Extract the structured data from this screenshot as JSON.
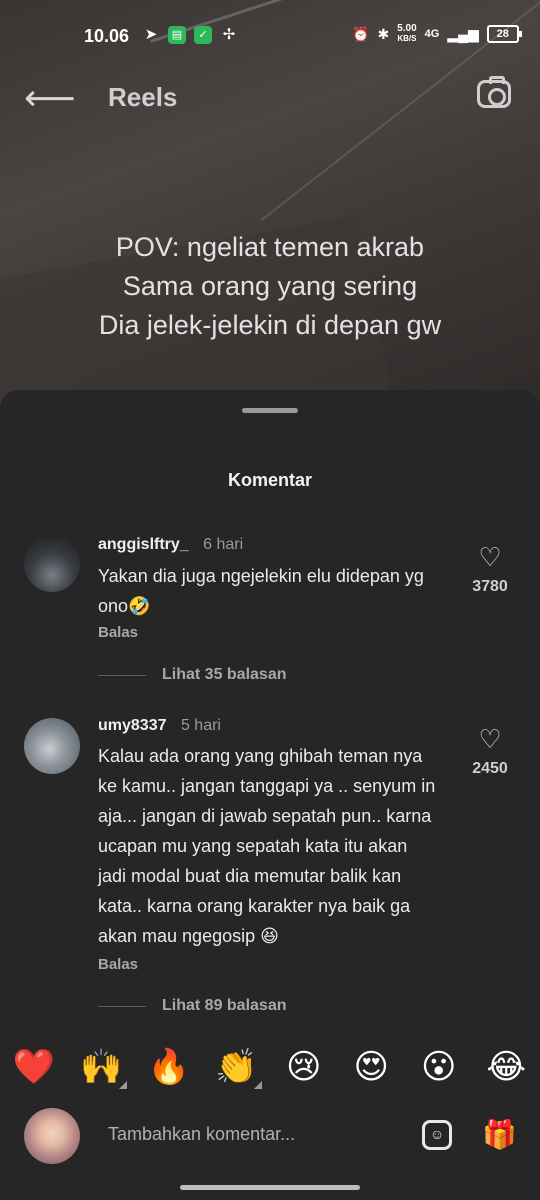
{
  "status_bar": {
    "time": "10.06",
    "speed_value": "5.00",
    "speed_unit": "KB/S",
    "network": "4G",
    "battery": "28"
  },
  "header": {
    "title": "Reels"
  },
  "reel": {
    "overlay_lines": [
      "POV: ngeliat temen akrab",
      "Sama orang yang sering",
      "Dia jelek-jelekin di depan gw"
    ]
  },
  "sheet": {
    "title": "Komentar"
  },
  "comments": [
    {
      "username": "anggislftry_",
      "time": "6 hari",
      "text": "Yakan dia juga ngejelekin elu didepan yg ono🤣",
      "likes": "3780",
      "reply_label": "Balas",
      "view_replies": "Lihat 35 balasan"
    },
    {
      "username": "umy8337",
      "time": "5 hari",
      "text": "Kalau ada orang yang ghibah teman nya ke kamu.. jangan tanggapi ya .. senyum in aja... jangan di jawab sepatah pun.. karna ucapan mu yang sepatah kata itu akan jadi modal buat dia memutar balik kan kata.. karna orang karakter nya baik ga akan mau ngegosip 😆",
      "likes": "2450",
      "reply_label": "Balas",
      "view_replies": "Lihat 89 balasan"
    }
  ],
  "emoji_bar": [
    "❤️",
    "🙌",
    "🔥",
    "👏",
    "😢",
    "😍",
    "😮",
    "😂"
  ],
  "composer": {
    "placeholder": "Tambahkan komentar..."
  }
}
